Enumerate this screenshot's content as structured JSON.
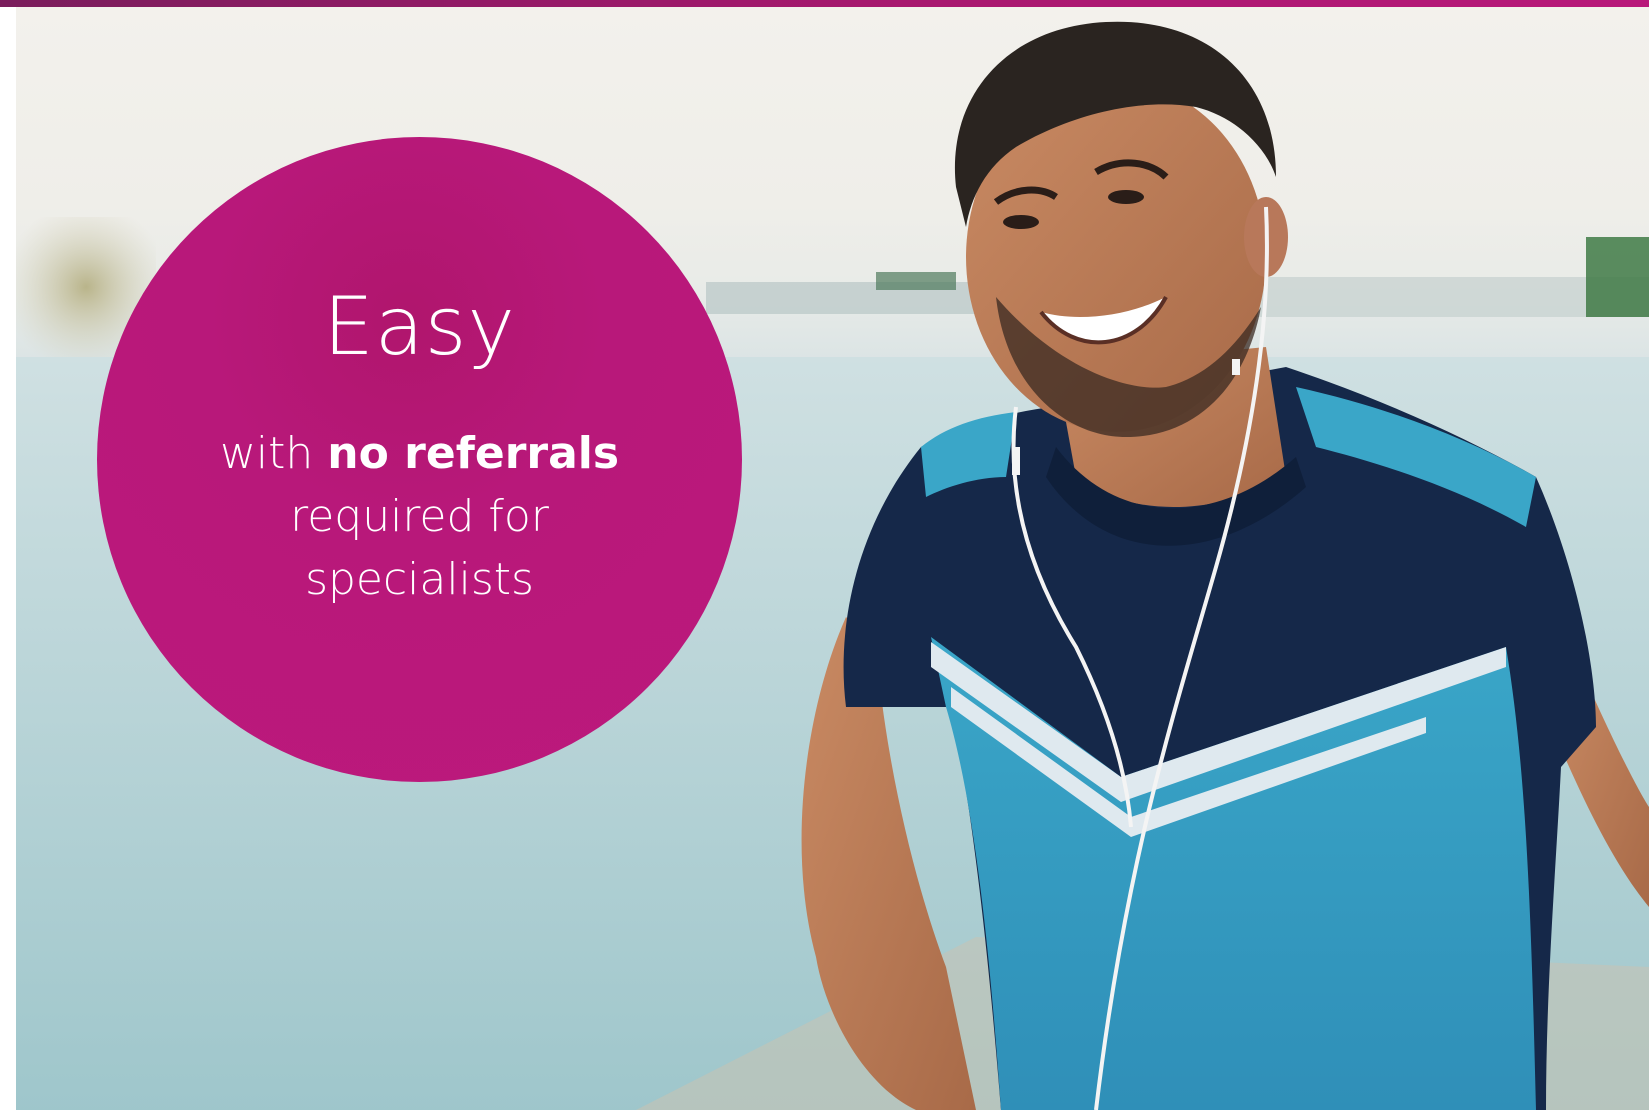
{
  "brand": {
    "accent": "#b8187a",
    "bar": "#7a1d5c",
    "text_on_accent": "#ffffff"
  },
  "hero": {
    "image_subject": "smiling man wearing earphones and a blue athletic t-shirt by the water",
    "badge": {
      "title": "Easy",
      "line1_prefix": "with",
      "line1_strong": "no referrals",
      "line2": "required for",
      "line3": "specialists"
    }
  }
}
